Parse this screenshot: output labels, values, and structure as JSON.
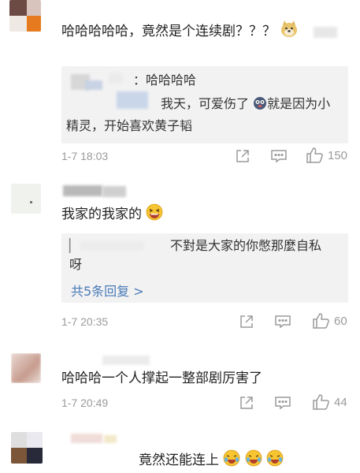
{
  "comments": [
    {
      "text": "哈哈哈哈哈，竟然是个连续剧？？？",
      "reply": {
        "name_suffix": "：哈哈哈哈",
        "text_line1": "我天，可爱伤了",
        "text_line1b": "就是因为小",
        "text_line2": "精灵，开始喜欢黄子韬"
      },
      "time": "1-7 18:03",
      "likes": "150"
    },
    {
      "text": "我家的我家的",
      "reply": {
        "prefix": "▏",
        "text_line1": "不對是大家的你憋那麼自私",
        "text_line2": "呀",
        "more": "共5条回复 >"
      },
      "time": "1-7 20:35",
      "likes": "60"
    },
    {
      "text": "哈哈哈一个人撑起一整部剧厉害了",
      "time": "1-7 20:49",
      "likes": "44"
    },
    {
      "text": "竟然还能连上"
    }
  ],
  "colors": {
    "meta": "#9a9a9a",
    "link": "#4a7ab8",
    "reply_bg": "#f2f2f2"
  },
  "icons": [
    "share-icon",
    "comment-icon",
    "thumbs-up-icon",
    "laughing-emoji",
    "crying-laugh-emoji",
    "doge-emoji",
    "dizzy-face-emoji"
  ]
}
